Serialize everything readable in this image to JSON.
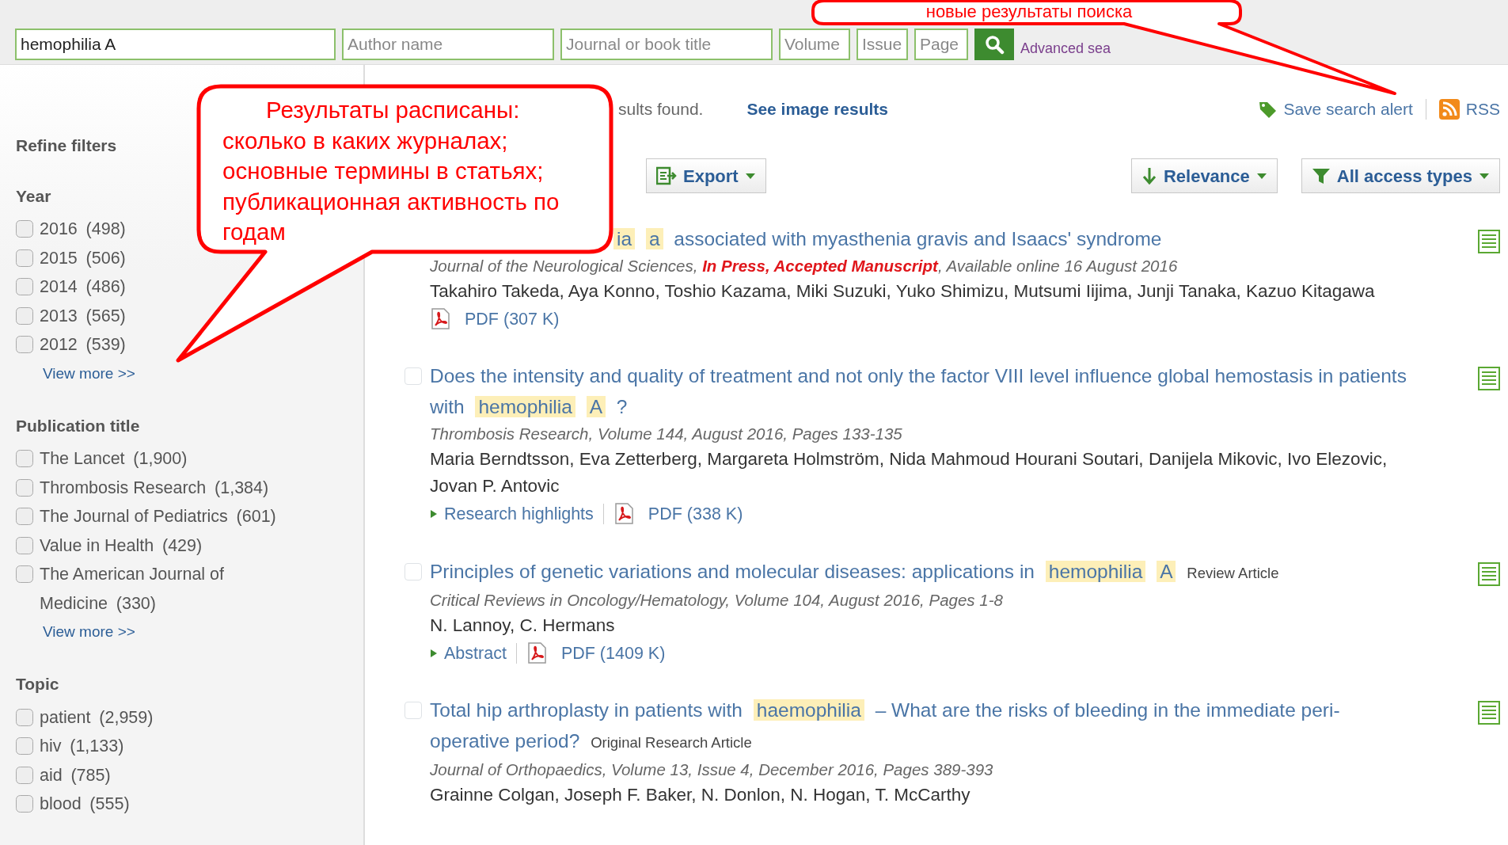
{
  "search_bar": {
    "fields": [
      {
        "value": "hemophilia A"
      },
      {
        "placeholder": "Author name"
      },
      {
        "placeholder": "Journal or book title"
      },
      {
        "placeholder": "Volume"
      },
      {
        "placeholder": "Issue"
      },
      {
        "placeholder": "Page"
      }
    ],
    "advanced_link": "Advanced sea"
  },
  "annotations": [
    {
      "kind": "top",
      "text": "новые результаты поиска"
    },
    {
      "kind": "side",
      "text": "Результаты расписаны: сколько в каких журналах; основные термины в статьях; публикационная активность по годам"
    }
  ],
  "sidebar": {
    "title": "Refine filters",
    "groups": [
      {
        "title": "Year",
        "items": [
          {
            "label": "2016",
            "count": "(498)",
            "checked": false
          },
          {
            "label": "2015",
            "count": "(506)",
            "checked": false
          },
          {
            "label": "2014",
            "count": "(486)",
            "checked": false
          },
          {
            "label": "2013",
            "count": "(565)",
            "checked": false
          },
          {
            "label": "2012",
            "count": "(539)",
            "checked": false
          }
        ],
        "view_more": "View more >>"
      },
      {
        "title": "Publication title",
        "items": [
          {
            "label": "The Lancet",
            "count": "(1,900)",
            "checked": false
          },
          {
            "label": "Thrombosis Research",
            "count": "(1,384)",
            "checked": false
          },
          {
            "label": "The Journal of Pediatrics",
            "count": "(601)",
            "checked": false
          },
          {
            "label": "Value in Health",
            "count": "(429)",
            "checked": false
          },
          {
            "label": "The American Journal of Medicine",
            "count": "(330)",
            "checked": false
          }
        ],
        "view_more": "View more >>"
      },
      {
        "title": "Topic",
        "items": [
          {
            "label": "patient",
            "count": "(2,959)",
            "checked": false
          },
          {
            "label": "hiv",
            "count": "(1,133)",
            "checked": false
          },
          {
            "label": "aid",
            "count": "(785)",
            "checked": false
          },
          {
            "label": "blood",
            "count": "(555)",
            "checked": false
          }
        ]
      }
    ]
  },
  "results_header": {
    "count_text": "sults found.",
    "image_link": "See image results",
    "alert": "Save search alert",
    "rss": "RSS"
  },
  "toolbar": {
    "export": "Export",
    "sort": "Relevance",
    "access": "All access types"
  },
  "results": [
    {
      "kind": "covered",
      "title_parts": [
        {
          "text": "ia",
          "highlight": true
        },
        {
          "text": "a",
          "highlight": true
        },
        {
          "text": "associated with myasthenia gravis and Isaacs' syndrome",
          "highlight": false
        }
      ],
      "source": "Journal of the Neurological Sciences, **In Press, Accepted Manuscript**, Available online 16 August 2016",
      "authors": "Takahiro Takeda, Aya Konno, Toshio Kazama, Miki Suzuki, Yuko Shimizu, Mutsumi Iijima, Junji Tanaka, Kazuo Kitagawa",
      "links": [
        {
          "kind": "pdf",
          "text": "PDF (307 K)"
        }
      ]
    },
    {
      "kind": "full",
      "checked": false,
      "title_parts": [
        {
          "text": "Does the intensity and quality of treatment and not only the factor VIII level influence global hemostasis in patients with",
          "highlight": false
        },
        {
          "text": "hemophilia",
          "highlight": true
        },
        {
          "text": "A",
          "highlight": true
        },
        {
          "text": "?",
          "highlight": false
        }
      ],
      "source": "Thrombosis Research, Volume 144, August 2016, Pages 133-135",
      "authors": "Maria Berndtsson, Eva Zetterberg, Margareta Holmström, Nida Mahmoud Hourani Soutari, Danijela Mikovic, Ivo Elezovic, Jovan P. Antovic",
      "links": [
        {
          "kind": "toggle",
          "text": "Research highlights"
        },
        {
          "kind": "pdf",
          "text": "PDF (338 K)"
        }
      ]
    },
    {
      "kind": "full",
      "checked": false,
      "title_parts": [
        {
          "text": "Principles of genetic variations and molecular diseases: applications in",
          "highlight": false
        },
        {
          "text": "hemophilia",
          "highlight": true
        },
        {
          "text": "A",
          "highlight": true
        }
      ],
      "article_type": "Review Article",
      "source": "Critical Reviews in Oncology/Hematology, Volume 104, August 2016, Pages 1-8",
      "authors": "N. Lannoy, C. Hermans",
      "links": [
        {
          "kind": "toggle",
          "text": "Abstract"
        },
        {
          "kind": "pdf",
          "text": "PDF (1409 K)"
        }
      ]
    },
    {
      "kind": "full",
      "checked": false,
      "title_parts": [
        {
          "text": "Total hip arthroplasty in patients with",
          "highlight": false
        },
        {
          "text": "haemophilia",
          "highlight": true
        },
        {
          "text": "– What are the risks of bleeding in the immediate peri-operative period?",
          "highlight": false
        }
      ],
      "article_type": "Original Research Article",
      "source": "Journal of Orthopaedics, Volume 13, Issue 4, December 2016, Pages 389-393",
      "authors": "Grainne Colgan, Joseph F. Baker, N. Donlon, N. Hogan, T. McCarthy"
    }
  ]
}
